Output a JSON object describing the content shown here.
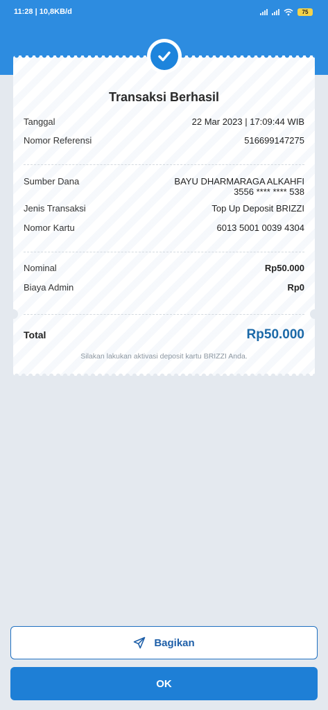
{
  "status_bar": {
    "time_speed": "11:28 | 10,8KB/d",
    "battery": "75"
  },
  "receipt": {
    "title": "Transaksi Berhasil",
    "rows_top": [
      {
        "label": "Tanggal",
        "value": "22 Mar 2023 | 17:09:44 WIB"
      },
      {
        "label": "Nomor Referensi",
        "value": "516699147275"
      }
    ],
    "sumber_dana": {
      "label": "Sumber Dana",
      "name": "BAYU DHARMARAGA ALKAHFI",
      "account": "3556 **** **** 538"
    },
    "jenis_transaksi": {
      "label": "Jenis Transaksi",
      "value": "Top Up Deposit BRIZZI"
    },
    "nomor_kartu": {
      "label": "Nomor Kartu",
      "value": "6013 5001 0039 4304"
    },
    "nominal": {
      "label": "Nominal",
      "value": "Rp50.000"
    },
    "biaya_admin": {
      "label": "Biaya Admin",
      "value": "Rp0"
    },
    "total": {
      "label": "Total",
      "value": "Rp50.000"
    },
    "footnote": "Silakan lakukan aktivasi deposit kartu BRIZZI Anda."
  },
  "buttons": {
    "share_label": "Bagikan",
    "ok_label": "OK"
  },
  "icons": {
    "check": "check-icon",
    "share": "send-icon"
  },
  "colors": {
    "primary": "#2d8ce0",
    "total_text": "#1b69a8"
  }
}
